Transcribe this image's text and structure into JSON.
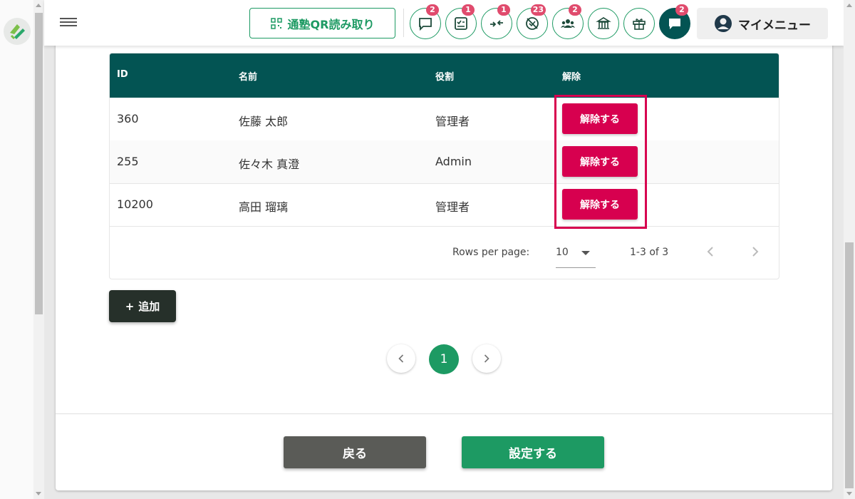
{
  "header": {
    "qr_button_label": "通塾QR読み取り",
    "icon_buttons": [
      {
        "icon": "chat-bubble-icon",
        "badge": "2"
      },
      {
        "icon": "checklist-icon",
        "badge": "1"
      },
      {
        "icon": "transfer-arrows-icon",
        "badge": "1"
      },
      {
        "icon": "no-attendance-icon",
        "badge": "23"
      },
      {
        "icon": "group-icon",
        "badge": "2"
      },
      {
        "icon": "school-icon",
        "badge": ""
      },
      {
        "icon": "gift-icon",
        "badge": ""
      },
      {
        "icon": "message-icon",
        "badge": "2"
      }
    ],
    "my_menu_label": "マイメニュー"
  },
  "table": {
    "headers": [
      "ID",
      "名前",
      "役割",
      "解除"
    ],
    "rows": [
      {
        "id": "360",
        "name": "佐藤 太郎",
        "role": "管理者",
        "action": "解除する"
      },
      {
        "id": "255",
        "name": "佐々木 真澄",
        "role": "Admin",
        "action": "解除する"
      },
      {
        "id": "10200",
        "name": "高田 瑠璃",
        "role": "管理者",
        "action": "解除する"
      }
    ],
    "rows_per_page_label": "Rows per page:",
    "rows_per_page_value": "10",
    "range_text": "1-3 of 3"
  },
  "add_button_label": "追加",
  "pagination": {
    "current_page": "1"
  },
  "footer": {
    "back_label": "戻る",
    "submit_label": "設定する"
  },
  "colors": {
    "brand_green": "#1d9a63",
    "header_teal": "#035453",
    "danger": "#d7004f"
  }
}
